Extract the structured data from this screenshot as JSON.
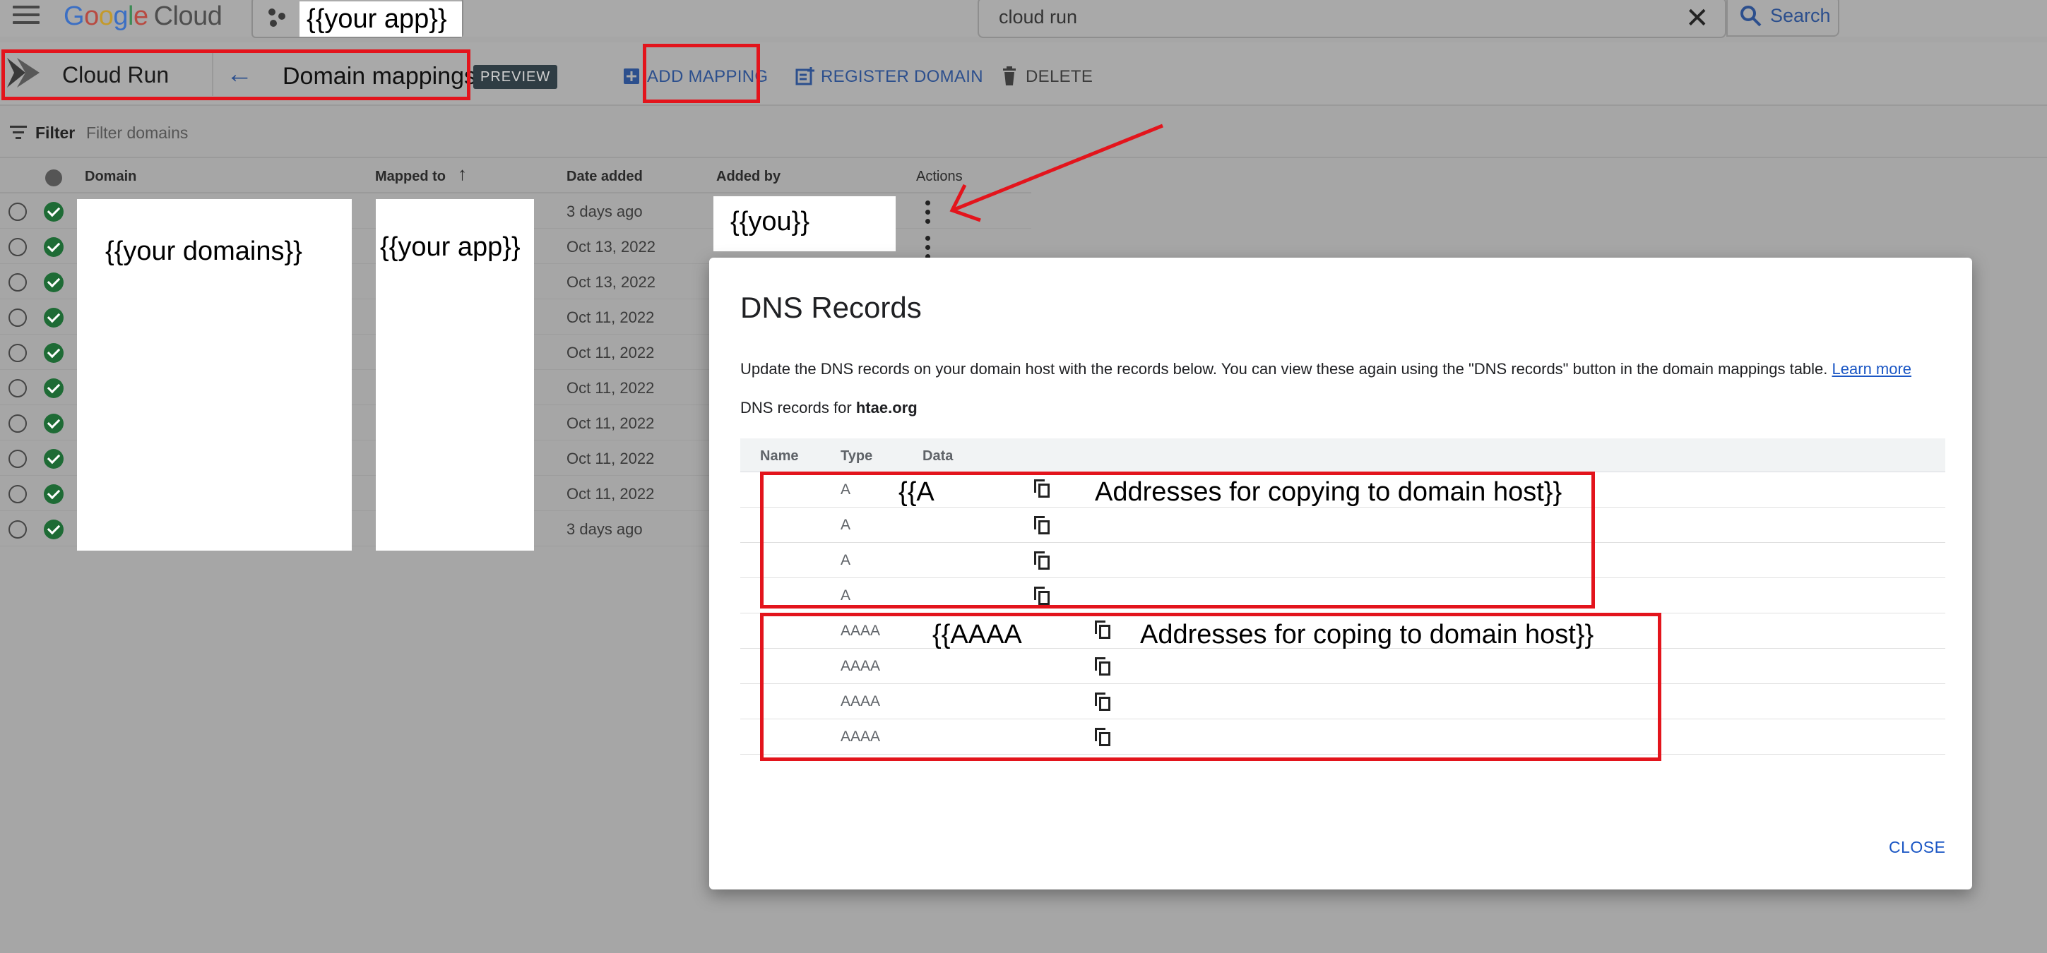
{
  "topbar": {
    "logo_google": [
      "G",
      "o",
      "o",
      "g",
      "l",
      "e"
    ],
    "logo_cloud": "Cloud",
    "project_name": "{{your app}}",
    "search_value": "cloud run",
    "search_clear": "✕",
    "search_button": "Search"
  },
  "toolbar": {
    "product_title": "Cloud Run",
    "back_arrow": "←",
    "page_title": "Domain mappings",
    "preview_badge": "PREVIEW",
    "add_mapping": "ADD MAPPING",
    "register_domain": "REGISTER DOMAIN",
    "delete": "DELETE"
  },
  "filter": {
    "label": "Filter",
    "placeholder": "Filter domains"
  },
  "table": {
    "headers": {
      "domain": "Domain",
      "mapped_to": "Mapped to",
      "sort_arrow": "↑",
      "date_added": "Date added",
      "added_by": "Added by",
      "actions": "Actions"
    },
    "dates": [
      "3 days ago",
      "Oct 13, 2022",
      "Oct 13, 2022",
      "Oct 11, 2022",
      "Oct 11, 2022",
      "Oct 11, 2022",
      "Oct 11, 2022",
      "Oct 11, 2022",
      "Oct 11, 2022",
      "3 days ago"
    ],
    "redacted_domains": "{{your domains}}",
    "redacted_app": "{{your app}}",
    "redacted_user": "{{you}}"
  },
  "dialog": {
    "title": "DNS Records",
    "description": "Update the DNS records on your domain host with the records below. You can view these again using the \"DNS records\" button in the domain mappings table.",
    "learn_more": "Learn more",
    "records_for_prefix": "DNS records for",
    "records_for_domain": "htae.org",
    "headers": {
      "name": "Name",
      "type": "Type",
      "data": "Data"
    },
    "types": [
      "A",
      "A",
      "A",
      "A",
      "AAAA",
      "AAAA",
      "AAAA",
      "AAAA"
    ],
    "annotation_a_prefix": "{{A",
    "annotation_a_text": "Addresses for copying to domain host}}",
    "annotation_aaaa_prefix": "{{AAAA",
    "annotation_aaaa_text": "Addresses for coping to domain host}}",
    "close": "CLOSE"
  },
  "colors": {
    "highlight_red": "#e3141c",
    "link_blue": "#1a56c4",
    "status_green": "#1e6b35"
  }
}
